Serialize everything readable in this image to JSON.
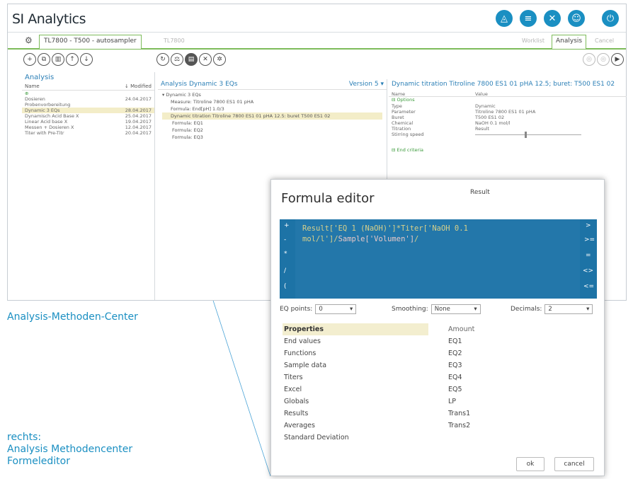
{
  "app": {
    "brand": "SI Analytics",
    "top_icons": [
      "shape-icon",
      "database-icon",
      "tools-icon",
      "user-icon",
      "power-icon"
    ],
    "tab_active": "TL7800 - T500 - autosampler",
    "tab_faded": "TL7800",
    "tab_right": [
      "Worklist",
      "Analysis",
      "Cancel"
    ],
    "toolbar_left": [
      "add-icon",
      "copy-icon",
      "delete-icon",
      "export-icon",
      "import-icon"
    ],
    "toolbar_mid": [
      "refresh-icon",
      "scale-icon",
      "print-icon",
      "close-icon",
      "settings-icon"
    ]
  },
  "analysis_list": {
    "title": "Analysis",
    "col_name": "Name",
    "col_modified": "↓ Modified",
    "rows": [
      {
        "name": "Dosieren",
        "modified": "24.04.2017"
      },
      {
        "name": "Probenvorbereitung",
        "modified": ""
      },
      {
        "name": "Dynamic 3 EQs",
        "modified": "28.04.2017"
      },
      {
        "name": "Dynamisch Acid Base X",
        "modified": "25.04.2017"
      },
      {
        "name": "Linear Acid base X",
        "modified": "19.04.2017"
      },
      {
        "name": "Messen + Dosieren X",
        "modified": "12.04.2017"
      },
      {
        "name": "Titer with Pre-Titr",
        "modified": "20.04.2017"
      }
    ]
  },
  "method": {
    "analysis_label": "Analysis",
    "name": "Dynamic 3 EQs",
    "version_label": "Version",
    "version": "5",
    "tree": [
      "▾ Dynamic 3 EQs",
      "Measure: Titroline 7800 ES1 01 pHA",
      "Formula: End[pH] 1.0/3",
      "Dynamic titration Titroline 7800 ES1 01 pHA 12.5: buret T500 ES1 02",
      "Formula: EQ1",
      "Formula: EQ2",
      "Formula: EQ3"
    ]
  },
  "details": {
    "title": "Dynamic titration Titroline 7800 ES1 01 pHA 12.5; buret: T500 ES1 02",
    "col_name": "Name",
    "col_value": "Value",
    "group1": "⊟ Options",
    "rows": [
      {
        "k": "Type",
        "v": "Dynamic"
      },
      {
        "k": "Parameter",
        "v": "Titroline 7800 ES1 01 pHA"
      },
      {
        "k": "Buret",
        "v": "T500 ES1 02"
      },
      {
        "k": "Chemical",
        "v": "NaOH 0.1 mol/l"
      },
      {
        "k": "Titration",
        "v": "Result"
      },
      {
        "k": "Stirring speed",
        "v": ""
      }
    ],
    "group2": "⊟ End criteria"
  },
  "labels": {
    "methods_center": "Analysis-Methoden-Center",
    "right_1": "rechts:",
    "right_2": "Analysis Methodencenter",
    "right_3": "Formeleditor"
  },
  "formula_editor": {
    "title": "Formula editor",
    "result_label": "Result",
    "left_ops": [
      "+",
      "-",
      "*",
      "/",
      "("
    ],
    "right_ops": [
      ">",
      ">=",
      "=",
      "<>",
      "<="
    ],
    "code_line1": "Result['EQ 1 (NaOH)']*Titer['NaOH 0.1",
    "code_line2": "mol/l']/",
    "code_hl": "Sample['Volumen']",
    "code_end": "/",
    "eq_points_label": "EQ points:",
    "eq_points_value": "0",
    "smoothing_label": "Smoothing:",
    "smoothing_value": "None",
    "decimals_label": "Decimals:",
    "decimals_value": "2",
    "properties": [
      "Properties",
      "End values",
      "Functions",
      "Sample data",
      "Titers",
      "Excel",
      "Globals",
      "Results",
      "Averages",
      "Standard Deviation"
    ],
    "values": [
      "Amount",
      "EQ1",
      "EQ2",
      "EQ3",
      "EQ4",
      "EQ5",
      "LP",
      "Trans1",
      "Trans2"
    ],
    "ok_label": "ok",
    "cancel_label": "cancel"
  }
}
